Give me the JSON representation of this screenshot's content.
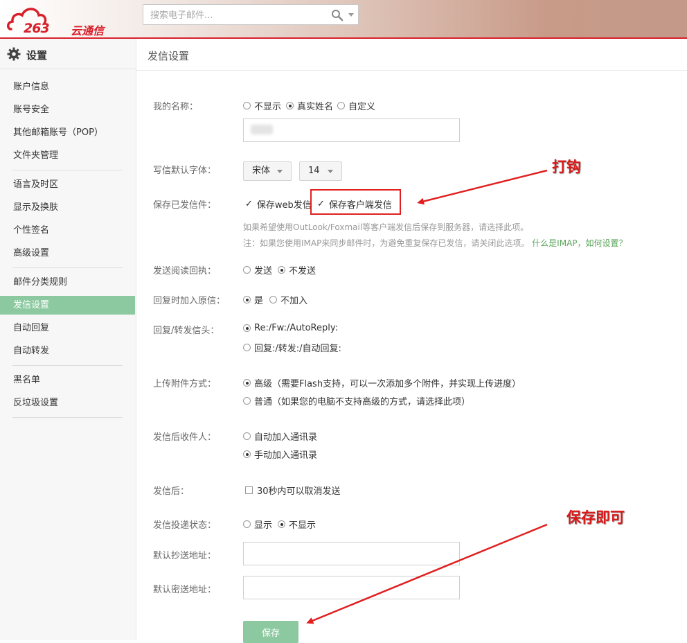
{
  "header": {
    "logo_number": "263",
    "logo_text": "云通信",
    "search_placeholder": "搜索电子邮件..."
  },
  "sidebar": {
    "title": "设置",
    "groups": [
      [
        "账户信息",
        "账号安全",
        "其他邮箱账号（POP）",
        "文件夹管理"
      ],
      [
        "语言及时区",
        "显示及换肤",
        "个性签名",
        "高级设置"
      ],
      [
        "邮件分类规则",
        "发信设置",
        "自动回复",
        "自动转发"
      ],
      [
        "黑名单",
        "反垃圾设置"
      ]
    ],
    "active": "发信设置"
  },
  "main": {
    "page_title": "发信设置",
    "my_name": {
      "label": "我的名称：",
      "options": [
        "不显示",
        "真实姓名",
        "自定义"
      ],
      "selected": "真实姓名"
    },
    "default_font": {
      "label": "写信默认字体：",
      "font": "宋体",
      "size": "14"
    },
    "save_sent": {
      "label": "保存已发信件：",
      "web_label": "保存web发信",
      "client_label": "保存客户端发信",
      "web_checked": true,
      "client_checked": true,
      "hint1": "如果希望使用OutLook/Foxmail等客户端发信后保存到服务器，请选择此项。",
      "hint2": "注：如果您使用IMAP来同步邮件时，为避免重复保存已发信，请关闭此选项。",
      "hint_link": "什么是IMAP，如何设置？"
    },
    "read_receipt": {
      "label": "发送阅读回执：",
      "options": [
        "发送",
        "不发送"
      ],
      "selected": "不发送"
    },
    "reply_include": {
      "label": "回复时加入原信：",
      "options": [
        "是",
        "不加入"
      ],
      "selected": "是"
    },
    "reply_prefix": {
      "label": "回复/转发信头：",
      "options": [
        "Re:/Fw:/AutoReply:",
        "回复:/转发:/自动回复:"
      ],
      "selected": "Re:/Fw:/AutoReply:"
    },
    "upload_mode": {
      "label": "上传附件方式：",
      "options": [
        "高级（需要Flash支持，可以一次添加多个附件，并实现上传进度）",
        "普通（如果您的电脑不支持高级的方式，请选择此项）"
      ],
      "selected": 0
    },
    "recipients": {
      "label": "发信后收件人：",
      "options": [
        "自动加入通讯录",
        "手动加入通讯录"
      ],
      "selected": "手动加入通讯录"
    },
    "after_send": {
      "label": "发信后：",
      "option": "30秒内可以取消发送",
      "checked": false
    },
    "delivery_status": {
      "label": "发信投递状态：",
      "options": [
        "显示",
        "不显示"
      ],
      "selected": "不显示"
    },
    "default_cc": {
      "label": "默认抄送地址：",
      "value": ""
    },
    "default_bcc": {
      "label": "默认密送地址：",
      "value": ""
    },
    "save_button": "保存"
  },
  "annotations": {
    "check_hint": "打钩",
    "save_hint": "保存即可"
  },
  "colors": {
    "brand_red": "#d8202b",
    "active_green": "#8cc9a0",
    "annotation_red": "#d91818",
    "link_green": "#5aa35a"
  }
}
